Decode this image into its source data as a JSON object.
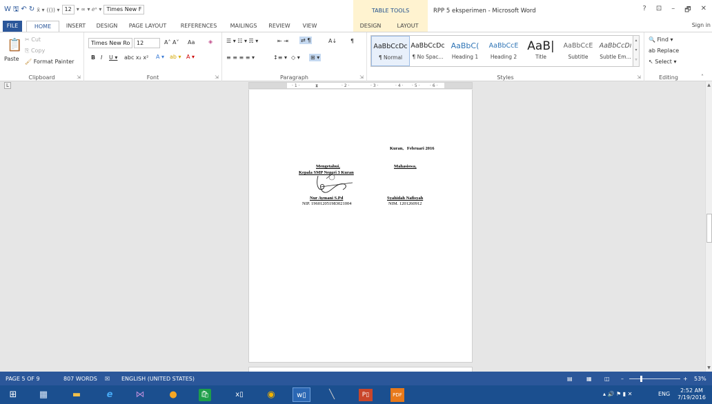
{
  "window": {
    "title": "RPP 5 eksperimen - Microsoft Word",
    "context_tab": "TABLE TOOLS",
    "help": "?",
    "restore_ribbon": "⊡",
    "minimize": "–",
    "maximize": "🗗",
    "close": "✕"
  },
  "qat": {
    "font_size": "12",
    "font_name": "Times New F",
    "icons": [
      "word-icon",
      "save-icon",
      "undo-icon",
      "redo-icon",
      "subscript-icon",
      "equation-icon",
      "symbol-icon"
    ]
  },
  "tabs": {
    "file": "FILE",
    "home": "HOME",
    "insert": "INSERT",
    "design": "DESIGN",
    "page_layout": "PAGE LAYOUT",
    "references": "REFERENCES",
    "mailings": "MAILINGS",
    "review": "REVIEW",
    "view": "VIEW",
    "table_design": "DESIGN",
    "table_layout": "LAYOUT",
    "sign_in": "Sign in"
  },
  "ribbon": {
    "clipboard": {
      "label": "Clipboard",
      "paste": "Paste",
      "cut": "Cut",
      "copy": "Copy",
      "format_painter": "Format Painter"
    },
    "font": {
      "label": "Font",
      "font_name": "Times New Ro",
      "font_size": "12",
      "case": "Aa",
      "grow": "A",
      "shrink": "A"
    },
    "paragraph": {
      "label": "Paragraph"
    },
    "styles": {
      "label": "Styles",
      "items": [
        {
          "preview": "AaBbCcDc",
          "name": "¶ Normal"
        },
        {
          "preview": "AaBbCcDc",
          "name": "¶ No Spac..."
        },
        {
          "preview": "AaBbC(",
          "name": "Heading 1"
        },
        {
          "preview": "AaBbCcE",
          "name": "Heading 2"
        },
        {
          "preview": "AaB|",
          "name": "Title"
        },
        {
          "preview": "AaBbCcE",
          "name": "Subtitle"
        },
        {
          "preview": "AaBbCcDı",
          "name": "Subtle Em..."
        }
      ]
    },
    "editing": {
      "label": "Editing",
      "find": "Find",
      "replace": "Replace",
      "select": "Select"
    }
  },
  "document": {
    "place_date": "Kuran,",
    "date": "Februari 2016",
    "left_title": "Mengetahui,",
    "left_role": "Kepala SMP Negeri 3 Kuran",
    "right_title": "Mahasiswa,",
    "left_name": "Nur Aymani S.Pd",
    "left_nip": "NIP. 196012051983021004",
    "right_name": "Syahidah Nafisyah",
    "right_nim": "NIM. 1201260912"
  },
  "status": {
    "page": "PAGE 5 OF 9",
    "words": "807 WORDS",
    "language": "ENGLISH (UNITED STATES)",
    "zoom": "53%",
    "zoom_level": 0.53
  },
  "taskbar": {
    "apps": [
      "windows-icon",
      "calculator-icon",
      "file-explorer-icon",
      "internet-explorer-icon",
      "visual-studio-icon",
      "media-icon",
      "store-icon",
      "excel-icon",
      "chrome-icon",
      "word-icon",
      "tool-icon",
      "powerpoint-icon",
      "pdf-icon"
    ],
    "language": "ENG",
    "time": "2:52 AM",
    "date": "7/19/2016"
  },
  "colors": {
    "accent": "#2b579a",
    "context": "#fff3d0",
    "taskbar": "#1b4f8f"
  }
}
